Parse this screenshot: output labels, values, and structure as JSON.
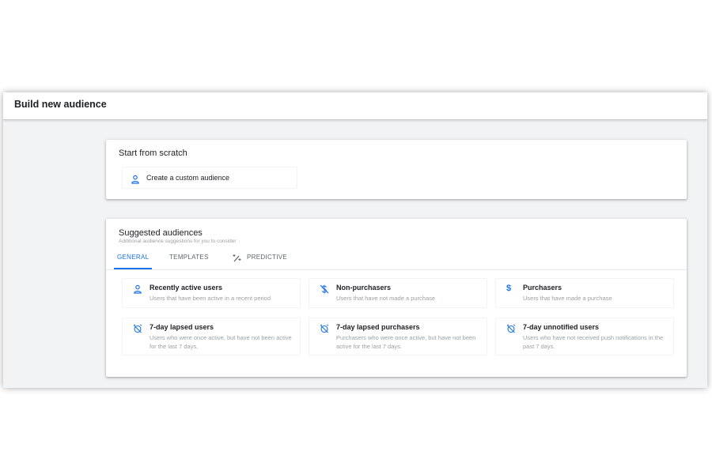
{
  "header": {
    "title": "Build new audience"
  },
  "scratch": {
    "title": "Start from scratch",
    "create_label": "Create a custom audience",
    "create_icon": "person-icon"
  },
  "suggested": {
    "title": "Suggested audiences",
    "subtitle": "Additional audience suggestions for you to consider",
    "tabs": [
      {
        "label": "GENERAL",
        "active": true
      },
      {
        "label": "TEMPLATES",
        "active": false
      },
      {
        "label": "PREDICTIVE",
        "active": false,
        "icon": "magic-wand-icon"
      }
    ],
    "cards": [
      {
        "name": "Recently active users",
        "desc": "Users that have been active in a recent period",
        "icon": "person-icon"
      },
      {
        "name": "Non-purchasers",
        "desc": "Users that have not made a purchase",
        "icon": "money-off-icon"
      },
      {
        "name": "Purchasers",
        "desc": "Users that have made a purchase",
        "icon": "dollar-icon"
      },
      {
        "name": "7-day lapsed users",
        "desc": "Users who were once active, but have not been active for the last 7 days.",
        "icon": "alarm-off-icon"
      },
      {
        "name": "7-day lapsed purchasers",
        "desc": "Purchasers who were once active, but have not been active for the last 7 days.",
        "icon": "alarm-off-icon"
      },
      {
        "name": "7-day unnotified users",
        "desc": "Users who have not received push notifications in the past 7 days.",
        "icon": "alarm-off-icon"
      }
    ]
  },
  "colors": {
    "accent": "#1a73e8",
    "text_primary": "#202124",
    "text_secondary": "#9aa0a6",
    "background": "#f1f3f4"
  }
}
